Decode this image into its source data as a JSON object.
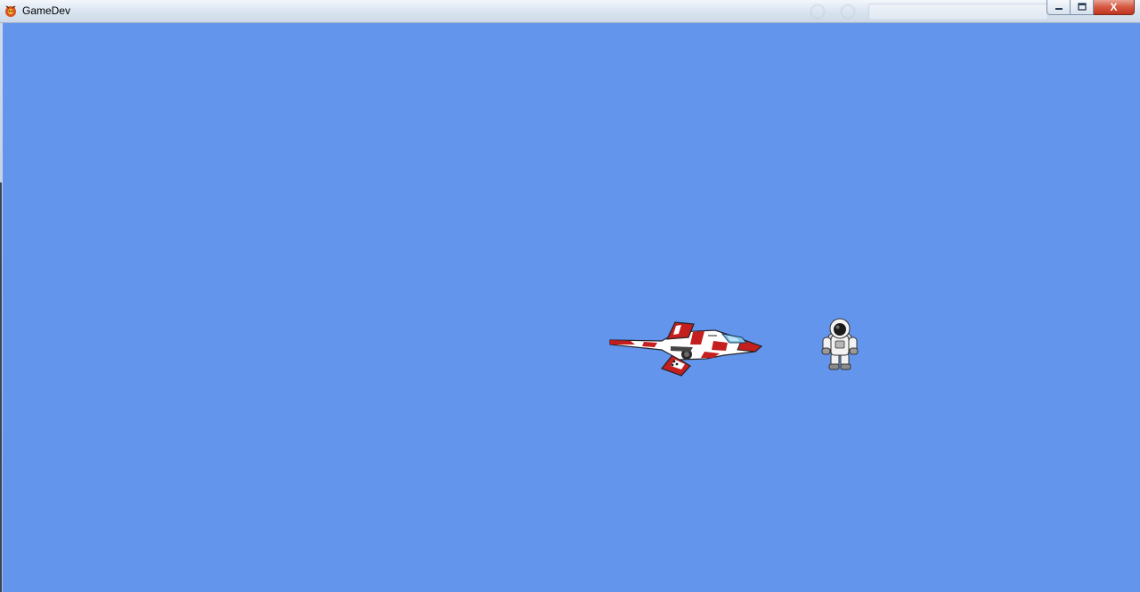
{
  "window": {
    "title": "GameDev",
    "icon": "game-app-icon",
    "controls": {
      "minimize_icon": "minimize-icon",
      "maximize_icon": "maximize-icon",
      "close_icon": "close-icon",
      "close_glyph": "X"
    }
  },
  "game": {
    "background_color": "#6495ED",
    "sprites": [
      {
        "name": "spaceship",
        "colors": [
          "#c41e1e",
          "#ffffff",
          "#7ec3e6"
        ]
      },
      {
        "name": "astronaut",
        "colors": [
          "#f2f2f2",
          "#1b1b1b"
        ]
      }
    ]
  }
}
